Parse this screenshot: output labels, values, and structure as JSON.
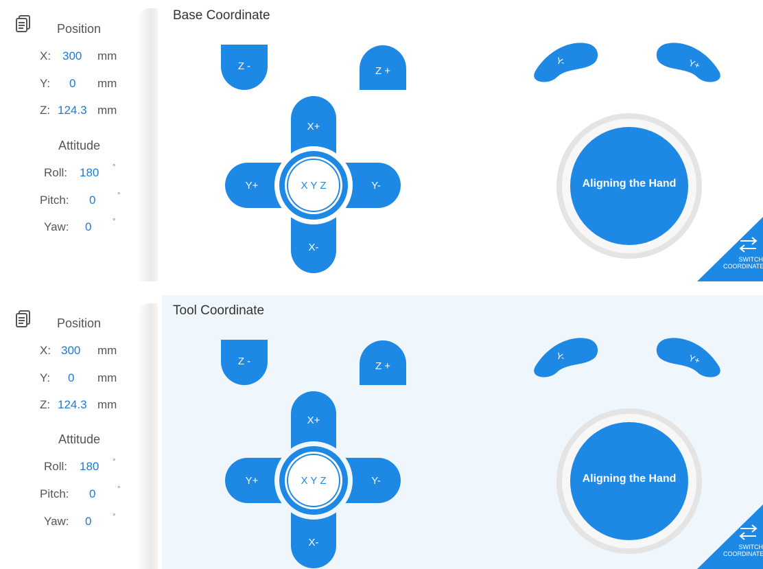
{
  "panels": [
    {
      "title": "Base Coordinate",
      "position": {
        "label": "Position",
        "x": {
          "label": "X:",
          "value": "300",
          "unit": "mm"
        },
        "y": {
          "label": "Y:",
          "value": "0",
          "unit": "mm"
        },
        "z": {
          "label": "Z:",
          "value": "124.3",
          "unit": "mm"
        }
      },
      "attitude": {
        "label": "Attitude",
        "roll": {
          "label": "Roll:",
          "value": "180",
          "unit": "°"
        },
        "pitch": {
          "label": "Pitch:",
          "value": "0",
          "unit": "°"
        },
        "yaw": {
          "label": "Yaw:",
          "value": "0",
          "unit": "°"
        }
      },
      "buttons": {
        "z_minus": "Z -",
        "z_plus": "Z +",
        "x_plus": "X+",
        "x_minus": "X-",
        "y_plus": "Y+",
        "y_minus": "Y-",
        "center": "X Y Z",
        "rot_left": "Y-",
        "rot_right": "Y+",
        "align": "Aligning the Hand",
        "switch_line1": "SWITCH",
        "switch_line2": "COORDINATE"
      }
    },
    {
      "title": "Tool Coordinate",
      "position": {
        "label": "Position",
        "x": {
          "label": "X:",
          "value": "300",
          "unit": "mm"
        },
        "y": {
          "label": "Y:",
          "value": "0",
          "unit": "mm"
        },
        "z": {
          "label": "Z:",
          "value": "124.3",
          "unit": "mm"
        }
      },
      "attitude": {
        "label": "Attitude",
        "roll": {
          "label": "Roll:",
          "value": "180",
          "unit": "°"
        },
        "pitch": {
          "label": "Pitch:",
          "value": "0",
          "unit": "°"
        },
        "yaw": {
          "label": "Yaw:",
          "value": "0",
          "unit": "°"
        }
      },
      "buttons": {
        "z_minus": "Z -",
        "z_plus": "Z +",
        "x_plus": "X+",
        "x_minus": "X-",
        "y_plus": "Y+",
        "y_minus": "Y-",
        "center": "X Y Z",
        "rot_left": "Y-",
        "rot_right": "Y+",
        "align": "Aligning the Hand",
        "switch_line1": "SWITCH",
        "switch_line2": "COORDINATE"
      }
    }
  ],
  "colors": {
    "accent": "#1e88e5",
    "value_text": "#1d79d6",
    "label_text": "#555555",
    "tool_bg": "#eff7fc"
  },
  "icons": {
    "info": "document-lines-icon",
    "switch": "swap-arrows-icon"
  }
}
